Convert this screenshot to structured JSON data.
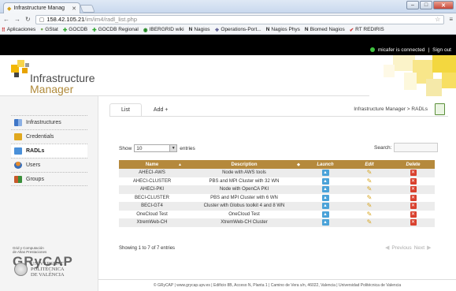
{
  "browser": {
    "tab_title": "Infrastructure Manag",
    "url_host": "158.42.105.21",
    "url_path": "/im/im4/radl_list.php",
    "bookmarks": [
      {
        "label": "Aplicaciones",
        "icon": "apps-icon"
      },
      {
        "label": "GStat",
        "icon": "gstat-icon"
      },
      {
        "label": "GOCDB",
        "icon": "gocdb-icon"
      },
      {
        "label": "GOCDB Regional",
        "icon": "gocdb-icon"
      },
      {
        "label": "IBERGRID wiki",
        "icon": "wiki-icon"
      },
      {
        "label": "Nagios",
        "icon": "nagios-icon"
      },
      {
        "label": "Operations-Port...",
        "icon": "ops-icon"
      },
      {
        "label": "Nagios Phys",
        "icon": "nagios-icon"
      },
      {
        "label": "Biomed Nagios",
        "icon": "nagios-icon"
      },
      {
        "label": "RT REDIRIS",
        "icon": "rt-icon"
      }
    ]
  },
  "header": {
    "status": "micafer is connected",
    "separator": "|",
    "sign_out": "Sign out",
    "logo_title": "Infrastructure",
    "logo_sub": "Manager"
  },
  "sidebar": {
    "items": [
      {
        "label": "Infrastructures",
        "icon": "infrastructures-icon",
        "color": "#3f76c7"
      },
      {
        "label": "Credentials",
        "icon": "credentials-icon",
        "color": "#e0a81f"
      },
      {
        "label": "RADLs",
        "icon": "radls-icon",
        "color": "#4a90d9"
      },
      {
        "label": "Users",
        "icon": "users-icon",
        "color": "#e58a2b"
      },
      {
        "label": "Groups",
        "icon": "groups-icon",
        "color": "#c8592a"
      }
    ],
    "grycap_small1": "Grid y Computación",
    "grycap_small2": "de Altas Prestaciones",
    "grycap_big": "GRyCAP",
    "upv_line1": "UNIVERSITAT",
    "upv_line2": "POLITÈCNICA",
    "upv_line3": "DE VALÈNCIA"
  },
  "main": {
    "tabs": [
      "List",
      "Add +"
    ],
    "breadcrumb": "Infrastructure Manager > RADLs",
    "show_label": "Show",
    "show_value": "10",
    "entries_label": "entries",
    "search_label": "Search:",
    "columns": [
      "Name",
      "Description",
      "Launch",
      "Edit",
      "Delete"
    ],
    "rows": [
      {
        "name": "AHECI-AWS",
        "description": "Node with AWS tools"
      },
      {
        "name": "AHECI-CLUSTER",
        "description": "PBS and MPI Cluster with 32 WN"
      },
      {
        "name": "AHECI-PKI",
        "description": "Node with OpenCA PKI"
      },
      {
        "name": "BECI-CLUSTER",
        "description": "PBS and MPI Cluster with 6 WN"
      },
      {
        "name": "BECI-GT4",
        "description": "Cluster with Globus toolkit 4 and 8 WN"
      },
      {
        "name": "OneCloud Test",
        "description": "OneCloud Test"
      },
      {
        "name": "XtremWeb-CH",
        "description": "XtremWeb-CH Cluster"
      }
    ],
    "info": "Showing 1 to 7 of 7 entries",
    "previous": "Previous",
    "next": "Next"
  },
  "footer": {
    "text": "© GRyCAP  |  www.grycap.upv.es  |  Edificio 8B, Acceso N, Planta 1  |  Camino de Vera s/n, 46022, Valencia  |  Universidad Politécnica de Valencia"
  }
}
